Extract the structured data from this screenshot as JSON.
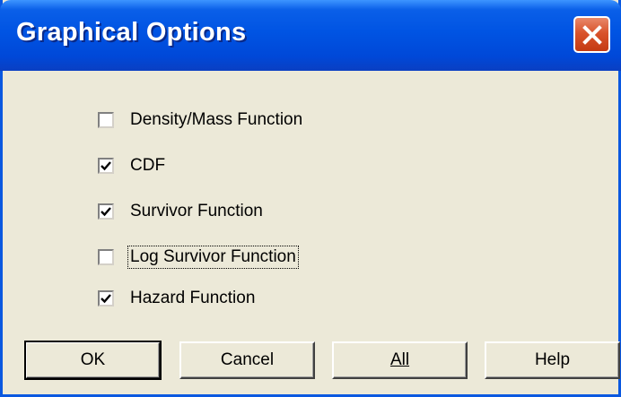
{
  "window": {
    "title": "Graphical Options"
  },
  "options": [
    {
      "label": "Density/Mass Function",
      "checked": false
    },
    {
      "label": "CDF",
      "checked": true
    },
    {
      "label": "Survivor Function",
      "checked": true
    },
    {
      "label": "Log Survivor Function",
      "checked": false,
      "focused": true
    },
    {
      "label": "Hazard Function",
      "checked": true
    }
  ],
  "buttons": {
    "ok": "OK",
    "cancel": "Cancel",
    "all": "All",
    "help": "Help"
  },
  "icons": {
    "close": "close-icon",
    "check": "checkmark-icon"
  },
  "colors": {
    "titlebar": "#0054e3",
    "close": "#d9532c",
    "face": "#ece9d8"
  }
}
